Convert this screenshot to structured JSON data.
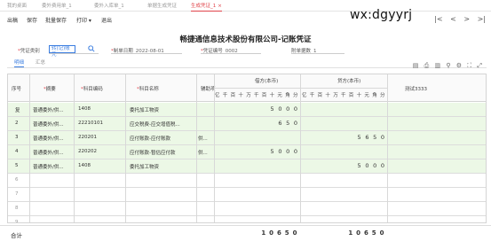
{
  "tabs": [
    {
      "label": "我的桌面",
      "active": false
    },
    {
      "label": "委外费用单_1",
      "active": false
    },
    {
      "label": "委外入库单_1",
      "active": false
    },
    {
      "label": "单据生成凭证",
      "active": false
    },
    {
      "label": "生成凭证_1",
      "active": true
    }
  ],
  "tab_close_glyph": "×",
  "toolbar": {
    "buttons": [
      "出稿",
      "保存",
      "批量保存",
      "打印 ▾",
      "退出"
    ]
  },
  "watermark": "wx:dgyyrj",
  "nav_glyphs": [
    "|<",
    "<",
    ">",
    ">|"
  ],
  "title": "畅捷通信息技术股份有限公司-记账凭证",
  "form": {
    "type_label": "凭证类别",
    "type_value": "转(记)账凭",
    "date_label": "制单日期",
    "date_value": "2022-08-01",
    "no_label": "凭证编号",
    "no_value": "0002",
    "attach_label": "附单据数",
    "attach_value": "1"
  },
  "subtabs": [
    {
      "label": "明细",
      "active": true
    },
    {
      "label": "汇总",
      "active": false
    }
  ],
  "right_icons": [
    "print-icon",
    "export-icon",
    "copy-icon",
    "link-icon",
    "settings-icon",
    "expand-icon",
    "fullscreen-icon"
  ],
  "right_icon_glyphs": [
    "▤",
    "⎙",
    "▥",
    "⚲",
    "⚙",
    "⛶",
    "⤢"
  ],
  "headers": {
    "seq": "序号",
    "summary": "摘要",
    "code": "科目编码",
    "name": "科目名称",
    "aux": "辅助项",
    "debit": "借方(本币)",
    "credit": "贷方(本币)",
    "extra": "测试3333",
    "digit_units": [
      "亿",
      "千",
      "百",
      "十",
      "万",
      "千",
      "百",
      "十",
      "元",
      "角",
      "分"
    ]
  },
  "rows": [
    {
      "seq": "复",
      "summary": "普通委外/供...",
      "code": "1408",
      "name": "委托加工物资",
      "aux": "",
      "debit": "5000",
      "credit": ""
    },
    {
      "seq": "2",
      "summary": "普通委外/供...",
      "code": "22210101",
      "name": "应交税费-应交增值税...",
      "aux": "",
      "debit": "650",
      "credit": ""
    },
    {
      "seq": "3",
      "summary": "普通委外/供...",
      "code": "220201",
      "name": "应付账款-应付账款",
      "aux": "供...",
      "debit": "",
      "credit": "5650"
    },
    {
      "seq": "4",
      "summary": "普通委外/供...",
      "code": "220202",
      "name": "应付账款-暂估应付款",
      "aux": "供...",
      "debit": "5000",
      "credit": ""
    },
    {
      "seq": "5",
      "summary": "普通委外/供...",
      "code": "1408",
      "name": "委托加工物资",
      "aux": "",
      "debit": "",
      "credit": "5000"
    }
  ],
  "empty_rows": [
    "6",
    "7",
    "8",
    "9"
  ],
  "total": {
    "label": "合计",
    "debit": "10650",
    "credit": "10650"
  }
}
